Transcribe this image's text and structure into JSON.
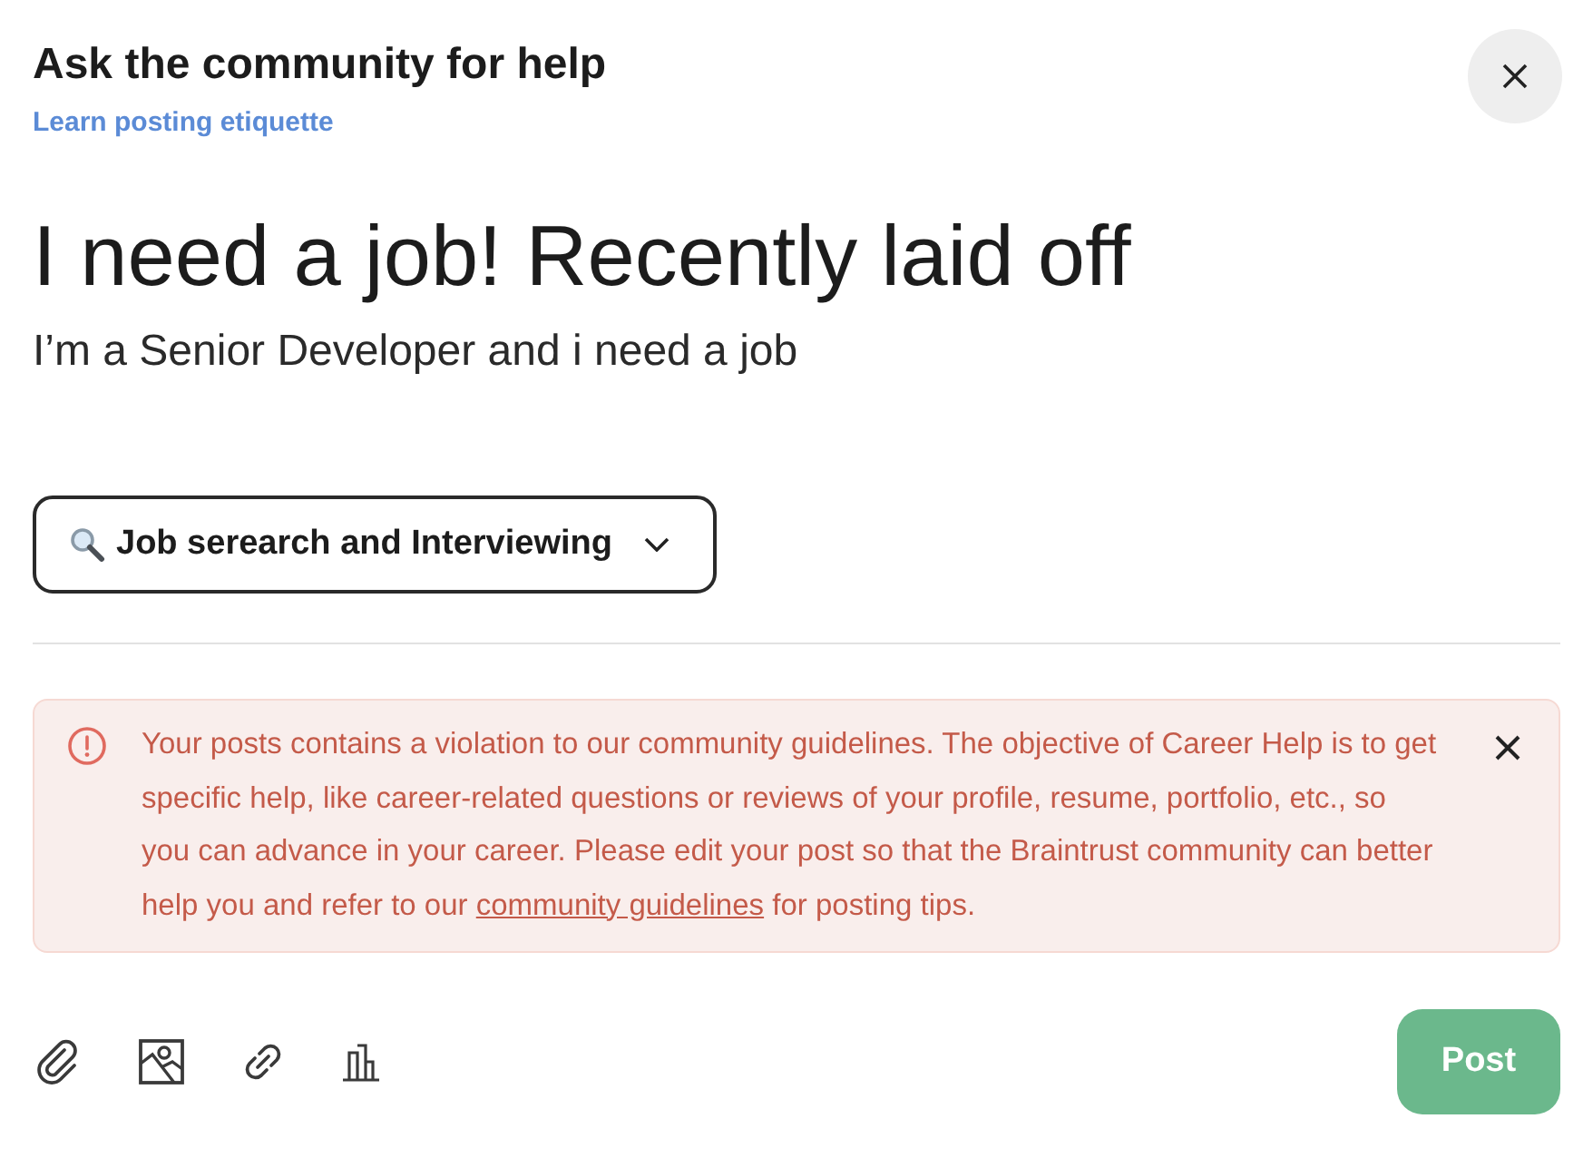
{
  "dialog": {
    "title": "Ask the community for help",
    "etiquette_link": "Learn posting etiquette"
  },
  "post": {
    "title": "I need a job! Recently laid off",
    "body": "I’m a Senior Developer and i need a job"
  },
  "category": {
    "label": "Job serearch and Interviewing"
  },
  "alert": {
    "kind": "error",
    "message_before": "Your posts contains a violation to our community guidelines. The objective of Career Help is to get specific help, like career-related questions or reviews of your profile, resume, portfolio, etc., so you can advance in your career. Please edit your post so that the Braintrust community can better help you and refer to our ",
    "link": "community guidelines",
    "message_after": " for posting tips."
  },
  "toolbar": [
    {
      "kind": "attachment"
    },
    {
      "kind": "image"
    },
    {
      "kind": "link"
    },
    {
      "kind": "poll"
    }
  ],
  "post_button": {
    "label": "Post"
  }
}
